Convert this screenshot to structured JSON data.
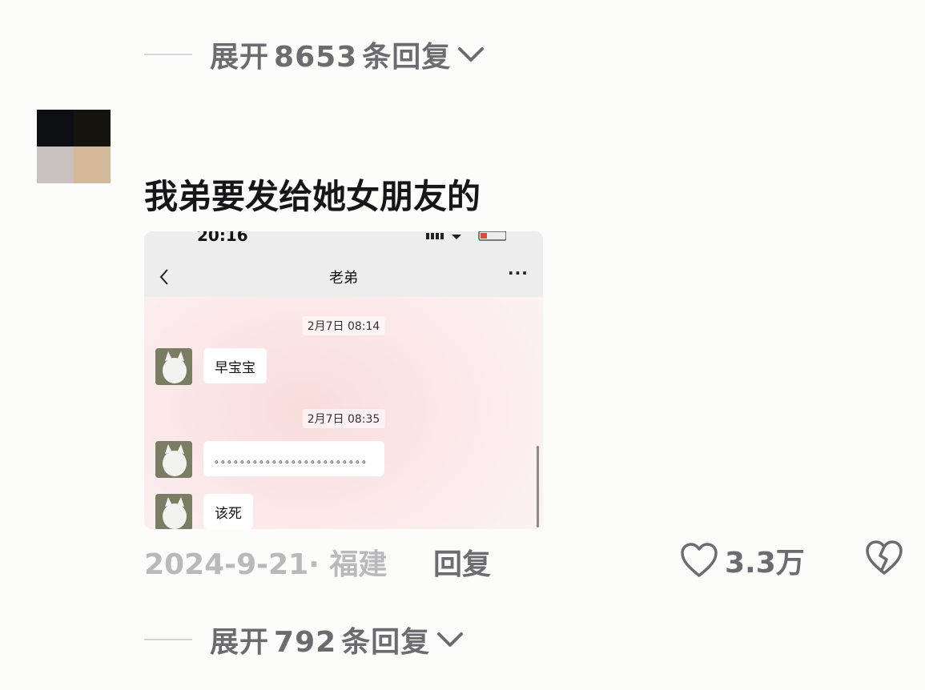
{
  "expand_top": {
    "prefix": "展开",
    "count": "8653",
    "suffix": "条回复"
  },
  "comment": {
    "text": "我弟要发给她女朋友的",
    "date_location": "2024-9-21· 福建",
    "reply_label": "回复",
    "like_count": "3.3万"
  },
  "screenshot": {
    "status_time": "20:16",
    "chat_title": "老弟",
    "more": "···",
    "messages": [
      {
        "timestamp": "2月7日 08:14",
        "text": "早宝宝"
      },
      {
        "timestamp": "2月7日 08:35",
        "text": "。。。。。。。。。。。。。。。。。。。。。。。。"
      },
      {
        "timestamp": "",
        "text": "该死"
      }
    ]
  },
  "expand_bottom": {
    "prefix": "展开",
    "count": "792",
    "suffix": "条回复"
  },
  "icons": {
    "chevron": "chevron-down-icon",
    "like": "heart-icon",
    "dislike": "broken-heart-icon",
    "back": "back-arrow-icon"
  }
}
